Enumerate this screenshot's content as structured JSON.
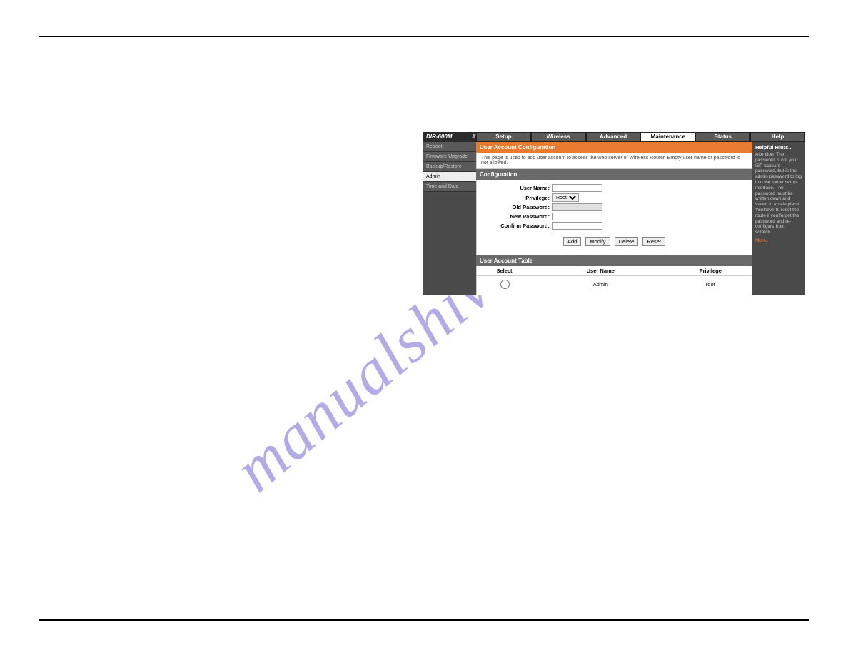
{
  "watermark": "manualshive.com",
  "model": "DIR-600M",
  "tabs": [
    "Setup",
    "Wireless",
    "Advanced",
    "Maintenance",
    "Status",
    "Help"
  ],
  "activeTab": "Maintenance",
  "sidebar": [
    "Reboot",
    "Firmware Upgrade",
    "Backup/Restore",
    "Admin",
    "Time and Date"
  ],
  "activeSide": "Admin",
  "section": {
    "title": "User Account Configuration",
    "desc": "This page is used to add user account to access the web server of Wireless Router. Empty user name or password is not allowed.",
    "confTitle": "Configuration",
    "fields": {
      "userName": "User Name:",
      "privilege": "Privilege:",
      "privValue": "Root",
      "oldPass": "Old Password:",
      "newPass": "New Password:",
      "confPass": "Confirm Password:"
    },
    "buttons": [
      "Add",
      "Modify",
      "Delete",
      "Reset"
    ],
    "tableTitle": "User Account Table",
    "tableHeaders": [
      "Select",
      "User Name",
      "Privilege"
    ],
    "tableRow": {
      "user": "Admin",
      "priv": "root"
    }
  },
  "help": {
    "title": "Helpful Hints...",
    "body": "Attention! The password is not your ISP account password, but is the admin password to log into the router setup interface. The password must be written down and saved in a safe place. You have to reset the route if you forget the password and re-configure from scratch.",
    "more": "More..."
  }
}
